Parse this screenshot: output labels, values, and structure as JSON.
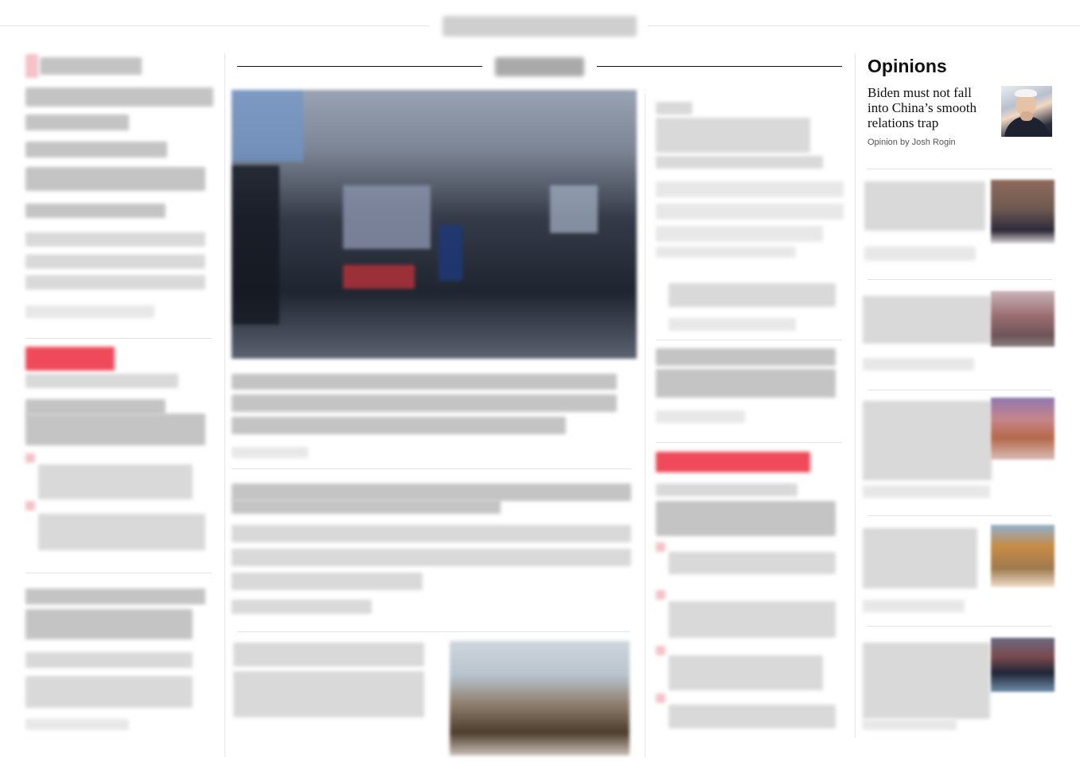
{
  "sections": {
    "top_label": "",
    "middle_label": ""
  },
  "opinions": {
    "title": "Opinions",
    "lead": {
      "headline": "Biden must not fall into China’s smooth relations trap",
      "byline": "Opinion by Josh Rogin",
      "thumb_icon": "portrait-photo"
    }
  },
  "colors": {
    "accent_red": "#ef4a5a",
    "divider": "#e3e3e3",
    "rule_dark": "#111111"
  }
}
